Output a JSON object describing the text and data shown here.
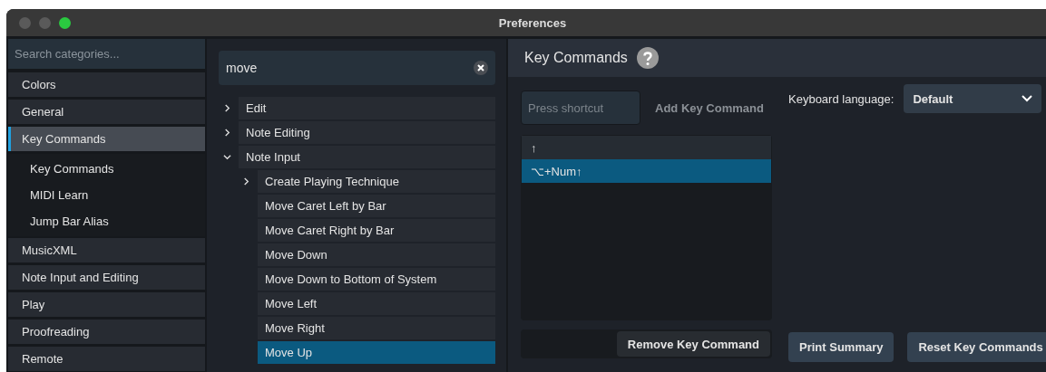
{
  "window": {
    "title": "Preferences"
  },
  "sidebar": {
    "search": {
      "placeholder": "Search categories..."
    },
    "items": [
      {
        "label": "Colors",
        "selected": false
      },
      {
        "label": "General",
        "selected": false
      },
      {
        "label": "Key Commands",
        "selected": true,
        "children": [
          {
            "label": "Key Commands",
            "selected": false
          },
          {
            "label": "MIDI Learn",
            "selected": false
          },
          {
            "label": "Jump Bar Alias",
            "selected": false
          }
        ]
      },
      {
        "label": "MusicXML",
        "selected": false
      },
      {
        "label": "Note Input and Editing",
        "selected": false
      },
      {
        "label": "Play",
        "selected": false
      },
      {
        "label": "Proofreading",
        "selected": false
      },
      {
        "label": "Remote",
        "selected": false
      }
    ]
  },
  "command_search": {
    "value": "move"
  },
  "command_tree": [
    {
      "kind": "group",
      "label": "Edit",
      "expanded": false
    },
    {
      "kind": "group",
      "label": "Note Editing",
      "expanded": false
    },
    {
      "kind": "group",
      "label": "Note Input",
      "expanded": true,
      "children": [
        {
          "kind": "group",
          "label": "Create Playing Technique",
          "expanded": false
        },
        {
          "kind": "command",
          "label": "Move Caret Left by Bar",
          "selected": false
        },
        {
          "kind": "command",
          "label": "Move Caret Right by Bar",
          "selected": false
        },
        {
          "kind": "command",
          "label": "Move Down",
          "selected": false
        },
        {
          "kind": "command",
          "label": "Move Down to Bottom of System",
          "selected": false
        },
        {
          "kind": "command",
          "label": "Move Left",
          "selected": false
        },
        {
          "kind": "command",
          "label": "Move Right",
          "selected": false
        },
        {
          "kind": "command",
          "label": "Move Up",
          "selected": true
        }
      ]
    }
  ],
  "detail": {
    "title": "Key Commands",
    "shortcut_field": {
      "placeholder": "Press shortcut"
    },
    "add_button": {
      "label": "Add Key Command",
      "disabled": true
    },
    "keyboard_language": {
      "label": "Keyboard language:",
      "value": "Default"
    },
    "shortcuts": [
      {
        "label": "↑",
        "selected": false
      },
      {
        "label": "⌥+Num↑",
        "selected": true
      }
    ],
    "remove_button": {
      "label": "Remove Key Command",
      "disabled": false
    },
    "buttons": [
      "Print Summary",
      "Reset Key Commands"
    ]
  }
}
